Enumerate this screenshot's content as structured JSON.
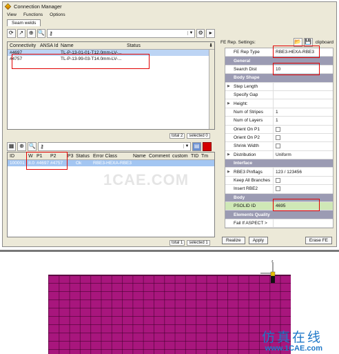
{
  "window": {
    "title": "Connection Manager"
  },
  "menu": [
    "View",
    "Functions",
    "Options"
  ],
  "tab": "Seam welds",
  "top_list": {
    "columns": [
      "Connectivity",
      "ANSA Id",
      "Name",
      "Status"
    ],
    "rows": [
      {
        "connectivity": "#4697",
        "ansa_id": "",
        "name": "TL-P-13-01-01-T12.0mm-LV-...",
        "status": ""
      },
      {
        "connectivity": "#4757",
        "ansa_id": "",
        "name": "TL-P-13-99-03-T14.0mm-LV-...",
        "status": ""
      }
    ],
    "status": {
      "total": "total 2",
      "selected": "selected 0"
    }
  },
  "bottom_list": {
    "columns": [
      "ID",
      "W",
      "P1",
      "P2",
      "P3",
      "Status",
      "Error Class",
      "Name",
      "Comment",
      "custom",
      "TID",
      "Tm"
    ],
    "row": {
      "id": "100001",
      "w": "8.0",
      "p1": "#4697",
      "p2": "#4757",
      "p3": "",
      "status": "Ok",
      "error_class": "RBE3-HEXA-RBE3"
    },
    "status": {
      "total": "total 1",
      "selected": "selected 1"
    }
  },
  "fe": {
    "settings_label": "FE Rep. Settings:",
    "clipboard": "clipboard",
    "rep_type_key": "FE Rep Type",
    "rep_type_value": "RBE3-HEXA-RBE3",
    "sections": {
      "general": "General",
      "body_shape": "Body Shape",
      "interface": "Interface",
      "body": "Body",
      "elements_quality": "Elements Quality"
    },
    "search_dist_key": "Search Dist",
    "search_dist_value": "10",
    "step_length": "Step Length",
    "specify_gap": "Specify Gap",
    "height": "Height:",
    "num_stripes_key": "Num of Stripes",
    "num_stripes_value": "1",
    "num_layers_key": "Num of Layers",
    "num_layers_value": "1",
    "orient_p1": "Orient On P1",
    "orient_p2": "Orient On P2",
    "shrink_width": "Shrink Width",
    "distribution_key": "Distribution",
    "distribution_value": "Uniform",
    "pinflags_key": "RBE3 Pinflags",
    "pinflags_value": "123 / 123456",
    "keep_all": "Keep All Branches",
    "insert_rbe2": "Insert RBE2",
    "psolid_key": "PSOLID ID",
    "psolid_value": "4695",
    "fail_if": "Fail If ASPECT >",
    "buttons": {
      "realize": "Realize",
      "apply": "Apply",
      "erase": "Erase FE"
    }
  },
  "watermark": "1CAE.COM",
  "brand": {
    "cn": "仿真在线",
    "url": "www.1CAE.com"
  },
  "colors": {
    "mesh": "#a8167d",
    "highlight": "#e00000",
    "section": "#9b9bb3",
    "green_row": "#cfe8b6",
    "brand": "#1f78c8"
  }
}
